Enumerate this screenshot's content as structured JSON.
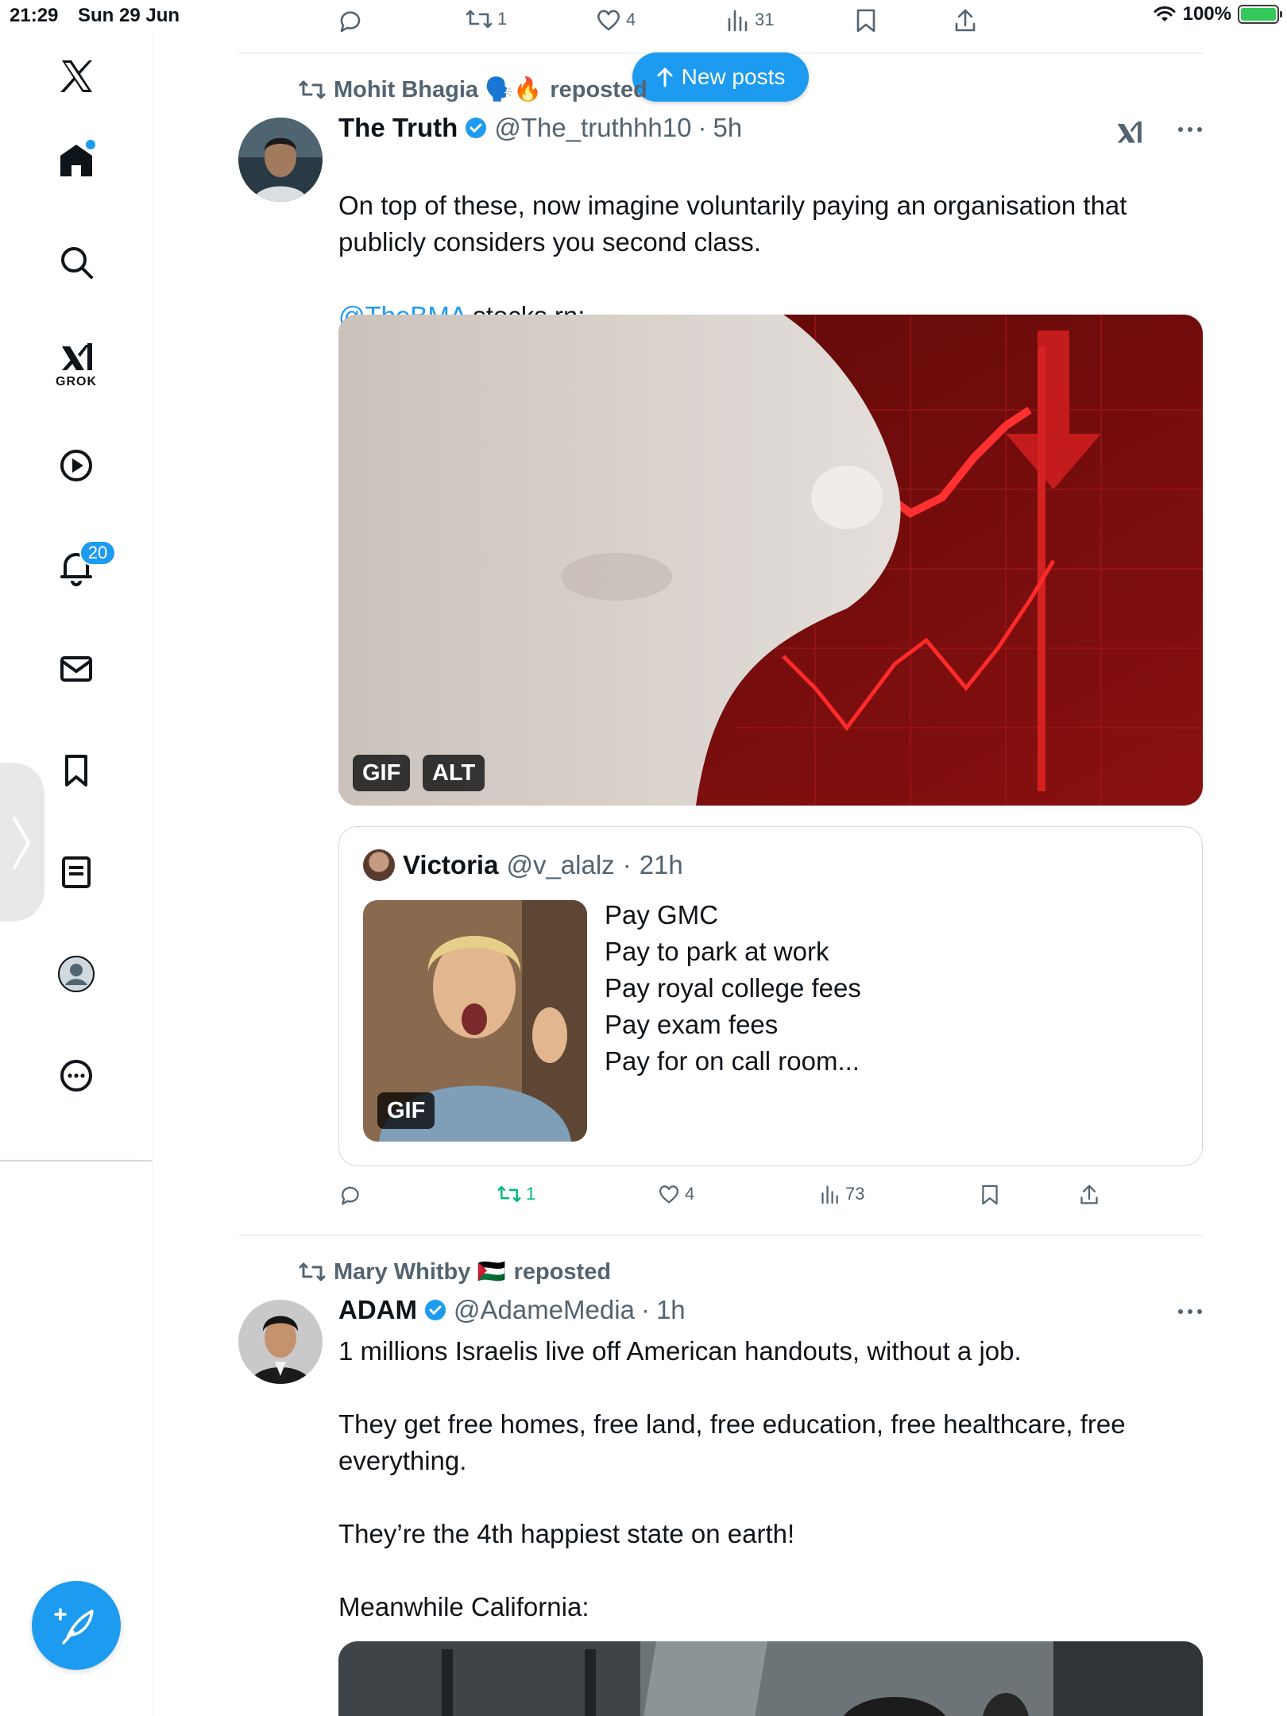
{
  "status_bar": {
    "time": "21:29",
    "date": "Sun 29 Jun",
    "battery": "100%"
  },
  "sidebar": {
    "grok_label": "GROK",
    "notifications_count": "20"
  },
  "top_actions": {
    "reposts": "1",
    "likes": "4",
    "views": "31"
  },
  "new_posts": {
    "label": "New posts"
  },
  "post1": {
    "reposter": "Mohit Bhagia 🗣️🔥",
    "reposted_label": "reposted",
    "name": "The Truth",
    "handle": "@The_truthhh10",
    "time": "5h",
    "text_line1": "On top of these, now imagine voluntarily paying an organisation that publicly considers you second class.",
    "mention": "@TheBMA",
    "text_after_mention": " stocks rn:",
    "media_badges": {
      "gif": "GIF",
      "alt": "ALT"
    },
    "quote": {
      "name": "Victoria",
      "handle": "@v_alalz",
      "time": "21h",
      "text": "Pay GMC\nPay to park at work\nPay royal college fees\nPay exam fees\nPay for on call room...",
      "gif_badge": "GIF"
    },
    "actions": {
      "reposts": "1",
      "likes": "4",
      "views": "73"
    }
  },
  "post2": {
    "reposter": "Mary Whitby 🇵🇸",
    "reposted_label": "reposted",
    "name": "ADAM",
    "handle": "@AdameMedia",
    "time": "1h",
    "text": "1 millions Israelis live off American handouts, without a job.\n\nThey get free homes, free land, free education, free healthcare, free everything.\n\nThey’re the 4th happiest state on earth!\n\nMeanwhile California:"
  },
  "colors": {
    "accent": "#1d9bf0",
    "secondary_text": "#536471",
    "repost_green": "#00ba7c"
  }
}
